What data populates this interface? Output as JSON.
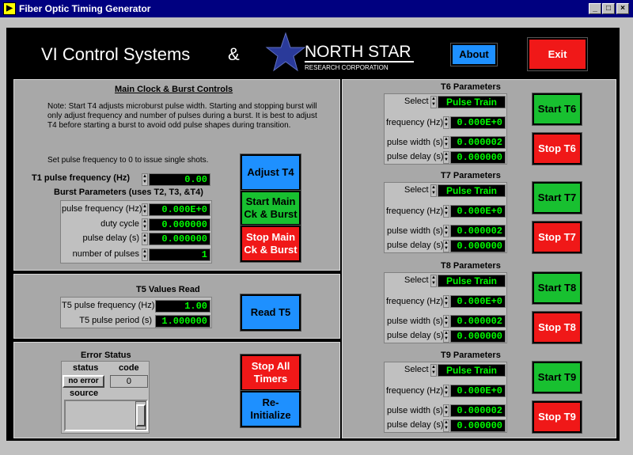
{
  "window": {
    "title": "Fiber Optic Timing Generator",
    "icon": "labview-icon",
    "min": "_",
    "max": "□",
    "close": "×"
  },
  "header": {
    "company": "VI Control Systems",
    "amp": "&",
    "logo_main": "NORTH STAR",
    "logo_sub": "RESEARCH CORPORATION",
    "about_label": "About",
    "exit_label": "Exit"
  },
  "main_clock": {
    "title": "Main Clock & Burst Controls",
    "note": "Note:  Start T4 adjusts microburst pulse width.  Starting and stopping burst will only adjust frequency and number of pulses during a burst. It is best to adjust T4 before starting a burst to avoid odd pulse shapes during transition.",
    "single_shot_note": "Set pulse frequency to 0 to issue single shots.",
    "t1_label": "T1 pulse frequency (Hz)",
    "t1_value": "0.00",
    "burst_title": "Burst Parameters (uses T2, T3, &T4)",
    "pulse_freq_label": "pulse frequency (Hz)",
    "pulse_freq_value": "0.000E+0",
    "duty_label": "duty cycle",
    "duty_value": "0.000000",
    "delay_label": "pulse delay (s)",
    "delay_value": "0.000000",
    "npulses_label": "number of pulses",
    "npulses_value": "1",
    "adjust_t4": "Adjust T4",
    "start_main": "Start Main Ck & Burst",
    "stop_main": "Stop Main Ck & Burst"
  },
  "t5": {
    "title": "T5 Values Read",
    "freq_label": "T5 pulse frequency (Hz)",
    "freq_value": "1.00",
    "period_label": "T5 pulse period (s)",
    "period_value": "1.000000",
    "read_label": "Read T5"
  },
  "error": {
    "title": "Error Status",
    "status_label": "status",
    "code_label": "code",
    "status_value": "no error",
    "code_value": "0",
    "source_label": "source",
    "stop_all": "Stop All Timers",
    "reinit": "Re-Initialize"
  },
  "timers": [
    {
      "title": "T6 Parameters",
      "select_label": "Select",
      "select_value": "Pulse Train",
      "freq_label": "frequency (Hz)",
      "freq_value": "0.000E+0",
      "width_label": "pulse width (s)",
      "width_value": "0.000002",
      "delay_label": "pulse delay (s)",
      "delay_value": "0.000000",
      "start": "Start T6",
      "stop": "Stop T6"
    },
    {
      "title": "T7 Parameters",
      "select_label": "Select",
      "select_value": "Pulse Train",
      "freq_label": "frequency (Hz)",
      "freq_value": "0.000E+0",
      "width_label": "pulse width (s)",
      "width_value": "0.000002",
      "delay_label": "pulse delay (s)",
      "delay_value": "0.000000",
      "start": "Start T7",
      "stop": "Stop T7"
    },
    {
      "title": "T8 Parameters",
      "select_label": "Select",
      "select_value": "Pulse Train",
      "freq_label": "frequency (Hz)",
      "freq_value": "0.000E+0",
      "width_label": "pulse width (s)",
      "width_value": "0.000002",
      "delay_label": "pulse delay (s)",
      "delay_value": "0.000000",
      "start": "Start T8",
      "stop": "Stop T8"
    },
    {
      "title": "T9 Parameters",
      "select_label": "Select",
      "select_value": "Pulse Train",
      "freq_label": "frequency (Hz)",
      "freq_value": "0.000E+0",
      "width_label": "pulse width (s)",
      "width_value": "0.000002",
      "delay_label": "pulse delay (s)",
      "delay_value": "0.000000",
      "start": "Start T9",
      "stop": "Stop T9"
    }
  ],
  "colors": {
    "display_bg": "#000000",
    "display_text": "#00ff00",
    "start": "#18c030",
    "stop": "#f01818",
    "action": "#1e90ff"
  }
}
